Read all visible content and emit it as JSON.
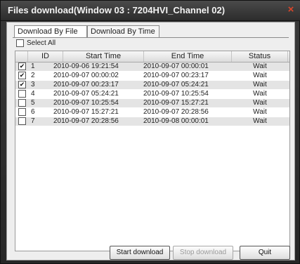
{
  "window": {
    "title": "Files download(Window 03 : 7204HVI_Channel 02)",
    "close_glyph": "×"
  },
  "tabs": [
    {
      "label": "Download By File",
      "active": true
    },
    {
      "label": "Download By Time",
      "active": false
    }
  ],
  "select_all": {
    "label": "Select All",
    "checked": false
  },
  "table": {
    "columns": [
      "",
      "ID",
      "Start Time",
      "End Time",
      "Status"
    ],
    "rows": [
      {
        "checked": true,
        "id": "1",
        "start": "2010-09-06  19:21:54",
        "end": "2010-09-07  00:00:01",
        "status": "Wait"
      },
      {
        "checked": true,
        "id": "2",
        "start": "2010-09-07  00:00:02",
        "end": "2010-09-07  00:23:17",
        "status": "Wait"
      },
      {
        "checked": true,
        "id": "3",
        "start": "2010-09-07  00:23:17",
        "end": "2010-09-07  05:24:21",
        "status": "Wait"
      },
      {
        "checked": false,
        "id": "4",
        "start": "2010-09-07  05:24:21",
        "end": "2010-09-07  10:25:54",
        "status": "Wait"
      },
      {
        "checked": false,
        "id": "5",
        "start": "2010-09-07  10:25:54",
        "end": "2010-09-07  15:27:21",
        "status": "Wait"
      },
      {
        "checked": false,
        "id": "6",
        "start": "2010-09-07  15:27:21",
        "end": "2010-09-07  20:28:56",
        "status": "Wait"
      },
      {
        "checked": false,
        "id": "7",
        "start": "2010-09-07  20:28:56",
        "end": "2010-09-08  00:00:01",
        "status": "Wait"
      }
    ]
  },
  "buttons": {
    "start": "Start download",
    "stop": "Stop download",
    "quit": "Quit"
  },
  "colors": {
    "title_bar": "#2c2c2c",
    "close": "#d9462a",
    "row_shade": "#e4e4e4"
  },
  "icons": {
    "check": "✔",
    "close": "close-icon"
  }
}
